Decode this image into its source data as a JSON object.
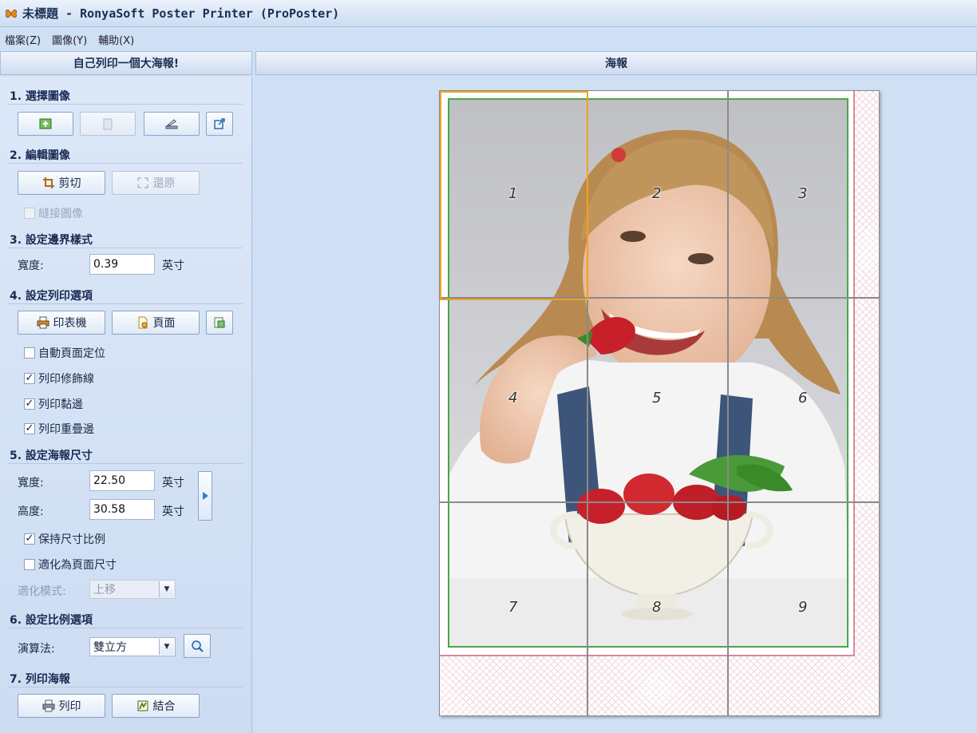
{
  "window": {
    "title": "未標題 - RonyaSoft Poster Printer (ProPoster)"
  },
  "menu": [
    {
      "label": "檔案(Z)"
    },
    {
      "label": "圖像(Y)"
    },
    {
      "label": "輔助(X)"
    }
  ],
  "left_header": "自己列印一個大海報!",
  "right_header": "海報",
  "sections": {
    "s1": "1. 選擇圖像",
    "s2": "2. 編輯圖像",
    "s3": "3. 設定邊界樣式",
    "s4": "4. 設定列印選項",
    "s5": "5. 設定海報尺寸",
    "s6": "6. 設定比例選項",
    "s7": "7. 列印海報"
  },
  "edit": {
    "crop_label": "剪切",
    "restore_label": "還原",
    "stitch_label": "縫接圖像",
    "stitch_checked": false
  },
  "border": {
    "width_label": "寬度:",
    "width_value": "0.39",
    "unit": "英寸"
  },
  "print_options": {
    "printer_label": "印表機",
    "page_label": "頁面",
    "auto_page": {
      "label": "自動頁面定位",
      "checked": false
    },
    "trim_lines": {
      "label": "列印修飾線",
      "checked": true
    },
    "glue_edge": {
      "label": "列印黏邊",
      "checked": true
    },
    "overlap_edge": {
      "label": "列印重疊邊",
      "checked": true
    }
  },
  "poster_size": {
    "width_label": "寬度:",
    "width_value": "22.50",
    "height_label": "高度:",
    "height_value": "30.58",
    "unit": "英寸",
    "keep_ratio": {
      "label": "保持尺寸比例",
      "checked": true
    },
    "fit_page": {
      "label": "適化為頁面尺寸",
      "checked": false
    },
    "fit_mode_label": "適化模式:",
    "fit_mode_value": "上移"
  },
  "scale": {
    "algo_label": "演算法:",
    "algo_value": "雙立方"
  },
  "print": {
    "print_label": "列印",
    "combine_label": "結合"
  },
  "tiles": [
    "1",
    "2",
    "3",
    "4",
    "5",
    "6",
    "7",
    "8",
    "9"
  ],
  "colors": {
    "selection": "#f3a21b",
    "margin_green": "#4aa64a",
    "margin_pink": "#d9889f"
  }
}
